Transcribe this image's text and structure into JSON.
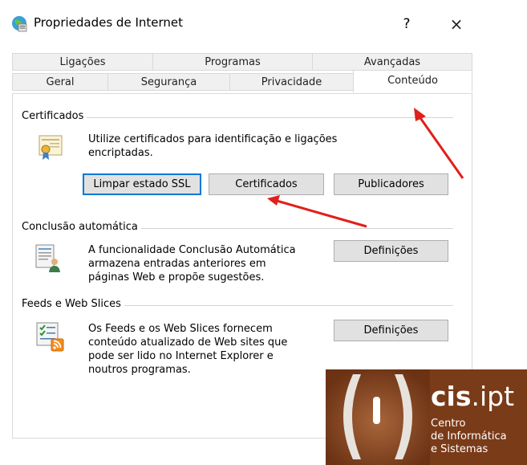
{
  "window": {
    "title": "Propriedades de Internet",
    "help": "?",
    "close": "×"
  },
  "tabs_row1": [
    "Ligações",
    "Programas",
    "Avançadas"
  ],
  "tabs_row2": [
    "Geral",
    "Segurança",
    "Privacidade",
    "Conteúdo"
  ],
  "active_tab": "Conteúdo",
  "certificates": {
    "heading": "Certificados",
    "description_line1": "Utilize certificados para identificação e ligações",
    "description_line2": "encriptadas.",
    "btn_clear_ssl": "Limpar estado SSL",
    "btn_certificates": "Certificados",
    "btn_publishers": "Publicadores"
  },
  "autocomplete": {
    "heading": "Conclusão automática",
    "description_line1": "A funcionalidade Conclusão Automática",
    "description_line2": "armazena entradas anteriores em",
    "description_line3": "páginas Web e propõe sugestões.",
    "btn_settings": "Definições"
  },
  "feeds": {
    "heading": "Feeds e Web Slices",
    "description_line1": "Os Feeds e os Web Slices fornecem",
    "description_line2": "conteúdo atualizado de Web sites que",
    "description_line3": "pode ser lido no Internet Explorer e",
    "description_line4": "noutros programas.",
    "btn_settings": "Definições"
  },
  "logo": {
    "main_bold": "cis",
    "main_rest": ".ipt",
    "line1": "Centro",
    "line2": "de Informática",
    "line3": "e Sistemas"
  },
  "colors": {
    "focus_border": "#0078d7",
    "arrow": "#e0201b",
    "logo_bg": "#7a3b18"
  }
}
